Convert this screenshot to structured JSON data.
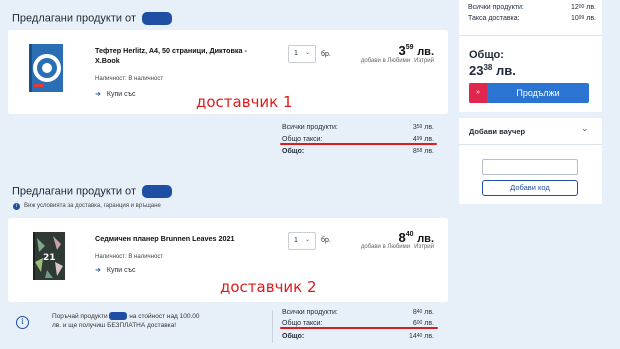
{
  "seller1": {
    "heading": "Предлагани продукти от",
    "product": {
      "name": "Тефтер Herlitz, A4, 50 страници, Диктовка - X.Book",
      "availability": "Наличност: В наличност",
      "buy_label": "Купи със",
      "qty": "1",
      "unit": "бр.",
      "price_int": "3",
      "price_dec": "59",
      "currency": "лв.",
      "favorites": "добави в Любими",
      "remove": "Изтрий"
    },
    "annotation": "доставчик 1",
    "summary": {
      "all_products_label": "Всички продукти:",
      "all_products_int": "3",
      "all_products_dec": "59",
      "fees_label": "Общо такси:",
      "fees_int": "4",
      "fees_dec": "99",
      "total_label": "Общо:",
      "total_int": "8",
      "total_dec": "58",
      "currency": "лв."
    }
  },
  "seller2": {
    "heading": "Предлагани продукти от",
    "conditions_link": "Виж условията за доставка, гаранция и връщане",
    "product": {
      "name": "Седмичен планер Brunnen Leaves 2021",
      "availability": "Наличност: В наличност",
      "buy_label": "Купи със",
      "qty": "1",
      "unit": "бр.",
      "price_int": "8",
      "price_dec": "40",
      "currency": "лв.",
      "favorites": "добави в Любими",
      "remove": "Изтрий"
    },
    "annotation": "доставчик 2",
    "free_delivery_note_a": "Поръчай продукти",
    "free_delivery_note_b": "на стойност над 100.00",
    "free_delivery_note_c": "лв. и ще получиш БЕЗПЛАТНА доставка!",
    "summary": {
      "all_products_label": "Всички продукти:",
      "all_products_int": "8",
      "all_products_dec": "40",
      "fees_label": "Общо такси:",
      "fees_int": "6",
      "fees_dec": "00",
      "total_label": "Общо:",
      "total_int": "14",
      "total_dec": "40",
      "currency": "лв."
    }
  },
  "sidebar": {
    "all_products_label": "Всички продукти:",
    "all_products_int": "12",
    "all_products_dec": "00",
    "delivery_fee_label": "Такса доставка:",
    "delivery_fee_int": "10",
    "delivery_fee_dec": "99",
    "currency": "лв.",
    "grand_total_label": "Общо:",
    "grand_total_int": "23",
    "grand_total_dec": "38",
    "continue_label": "Продължи",
    "voucher_label": "Добави ваучер",
    "add_code_label": "Добави код"
  },
  "colors": {
    "accent_blue": "#2c74d1",
    "annotation_red": "#e01b1b",
    "redaction": "#1e4fa3"
  }
}
